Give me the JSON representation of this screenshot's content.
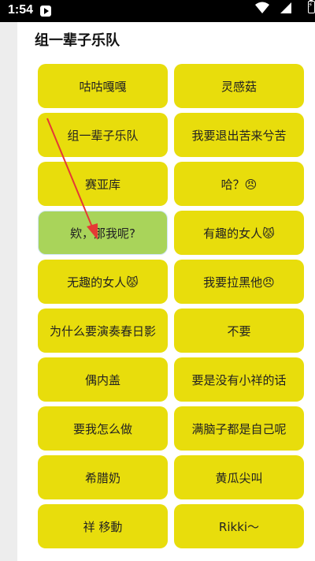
{
  "status": {
    "time": "1:54"
  },
  "page": {
    "title": "组一辈子乐队"
  },
  "tiles": [
    "咕咕嘎嘎",
    "灵感菇",
    "组一辈子乐队",
    "我要退出苦来兮苦",
    "赛亚库",
    "哈？😠",
    "欸，那我呢?",
    "有趣的女人😾",
    "无趣的女人😾",
    "我要拉黑他😠",
    "为什么要演奏春日影",
    "不要",
    "偶内盖",
    "要是没有小祥的话",
    "要我怎么做",
    "满脑子都是自己呢",
    "希腊奶",
    "黄瓜尖叫",
    "祥 移動",
    "Rikki～"
  ],
  "colors": {
    "tile": "#e8dd0c",
    "active_tile": "#a9d45a",
    "arrow": "#e53935"
  },
  "icons": [
    "play-icon",
    "wifi-icon",
    "signal-icon",
    "battery-icon",
    "arrow-annotation"
  ]
}
